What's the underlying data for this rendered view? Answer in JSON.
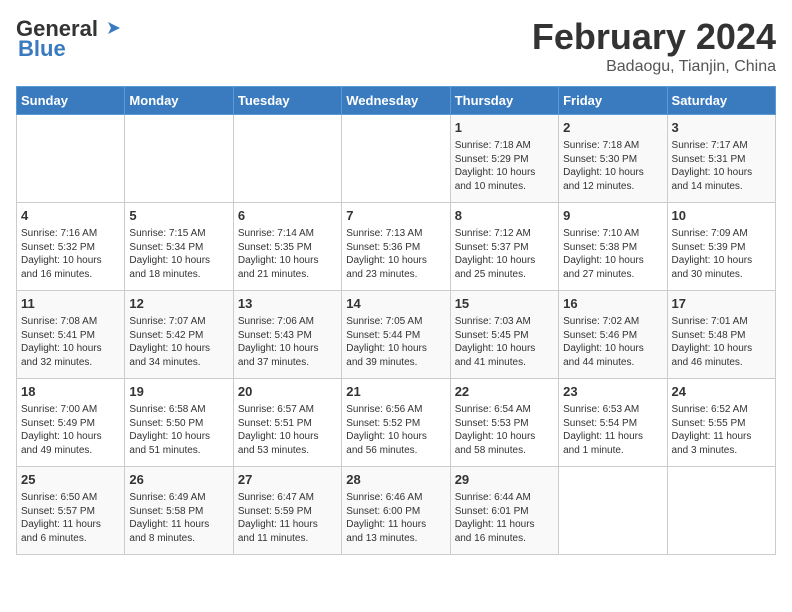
{
  "header": {
    "logo_general": "General",
    "logo_blue": "Blue",
    "title": "February 2024",
    "subtitle": "Badaogu, Tianjin, China"
  },
  "weekdays": [
    "Sunday",
    "Monday",
    "Tuesday",
    "Wednesday",
    "Thursday",
    "Friday",
    "Saturday"
  ],
  "weeks": [
    [
      {
        "day": "",
        "info": ""
      },
      {
        "day": "",
        "info": ""
      },
      {
        "day": "",
        "info": ""
      },
      {
        "day": "",
        "info": ""
      },
      {
        "day": "1",
        "info": "Sunrise: 7:18 AM\nSunset: 5:29 PM\nDaylight: 10 hours\nand 10 minutes."
      },
      {
        "day": "2",
        "info": "Sunrise: 7:18 AM\nSunset: 5:30 PM\nDaylight: 10 hours\nand 12 minutes."
      },
      {
        "day": "3",
        "info": "Sunrise: 7:17 AM\nSunset: 5:31 PM\nDaylight: 10 hours\nand 14 minutes."
      }
    ],
    [
      {
        "day": "4",
        "info": "Sunrise: 7:16 AM\nSunset: 5:32 PM\nDaylight: 10 hours\nand 16 minutes."
      },
      {
        "day": "5",
        "info": "Sunrise: 7:15 AM\nSunset: 5:34 PM\nDaylight: 10 hours\nand 18 minutes."
      },
      {
        "day": "6",
        "info": "Sunrise: 7:14 AM\nSunset: 5:35 PM\nDaylight: 10 hours\nand 21 minutes."
      },
      {
        "day": "7",
        "info": "Sunrise: 7:13 AM\nSunset: 5:36 PM\nDaylight: 10 hours\nand 23 minutes."
      },
      {
        "day": "8",
        "info": "Sunrise: 7:12 AM\nSunset: 5:37 PM\nDaylight: 10 hours\nand 25 minutes."
      },
      {
        "day": "9",
        "info": "Sunrise: 7:10 AM\nSunset: 5:38 PM\nDaylight: 10 hours\nand 27 minutes."
      },
      {
        "day": "10",
        "info": "Sunrise: 7:09 AM\nSunset: 5:39 PM\nDaylight: 10 hours\nand 30 minutes."
      }
    ],
    [
      {
        "day": "11",
        "info": "Sunrise: 7:08 AM\nSunset: 5:41 PM\nDaylight: 10 hours\nand 32 minutes."
      },
      {
        "day": "12",
        "info": "Sunrise: 7:07 AM\nSunset: 5:42 PM\nDaylight: 10 hours\nand 34 minutes."
      },
      {
        "day": "13",
        "info": "Sunrise: 7:06 AM\nSunset: 5:43 PM\nDaylight: 10 hours\nand 37 minutes."
      },
      {
        "day": "14",
        "info": "Sunrise: 7:05 AM\nSunset: 5:44 PM\nDaylight: 10 hours\nand 39 minutes."
      },
      {
        "day": "15",
        "info": "Sunrise: 7:03 AM\nSunset: 5:45 PM\nDaylight: 10 hours\nand 41 minutes."
      },
      {
        "day": "16",
        "info": "Sunrise: 7:02 AM\nSunset: 5:46 PM\nDaylight: 10 hours\nand 44 minutes."
      },
      {
        "day": "17",
        "info": "Sunrise: 7:01 AM\nSunset: 5:48 PM\nDaylight: 10 hours\nand 46 minutes."
      }
    ],
    [
      {
        "day": "18",
        "info": "Sunrise: 7:00 AM\nSunset: 5:49 PM\nDaylight: 10 hours\nand 49 minutes."
      },
      {
        "day": "19",
        "info": "Sunrise: 6:58 AM\nSunset: 5:50 PM\nDaylight: 10 hours\nand 51 minutes."
      },
      {
        "day": "20",
        "info": "Sunrise: 6:57 AM\nSunset: 5:51 PM\nDaylight: 10 hours\nand 53 minutes."
      },
      {
        "day": "21",
        "info": "Sunrise: 6:56 AM\nSunset: 5:52 PM\nDaylight: 10 hours\nand 56 minutes."
      },
      {
        "day": "22",
        "info": "Sunrise: 6:54 AM\nSunset: 5:53 PM\nDaylight: 10 hours\nand 58 minutes."
      },
      {
        "day": "23",
        "info": "Sunrise: 6:53 AM\nSunset: 5:54 PM\nDaylight: 11 hours\nand 1 minute."
      },
      {
        "day": "24",
        "info": "Sunrise: 6:52 AM\nSunset: 5:55 PM\nDaylight: 11 hours\nand 3 minutes."
      }
    ],
    [
      {
        "day": "25",
        "info": "Sunrise: 6:50 AM\nSunset: 5:57 PM\nDaylight: 11 hours\nand 6 minutes."
      },
      {
        "day": "26",
        "info": "Sunrise: 6:49 AM\nSunset: 5:58 PM\nDaylight: 11 hours\nand 8 minutes."
      },
      {
        "day": "27",
        "info": "Sunrise: 6:47 AM\nSunset: 5:59 PM\nDaylight: 11 hours\nand 11 minutes."
      },
      {
        "day": "28",
        "info": "Sunrise: 6:46 AM\nSunset: 6:00 PM\nDaylight: 11 hours\nand 13 minutes."
      },
      {
        "day": "29",
        "info": "Sunrise: 6:44 AM\nSunset: 6:01 PM\nDaylight: 11 hours\nand 16 minutes."
      },
      {
        "day": "",
        "info": ""
      },
      {
        "day": "",
        "info": ""
      }
    ]
  ]
}
